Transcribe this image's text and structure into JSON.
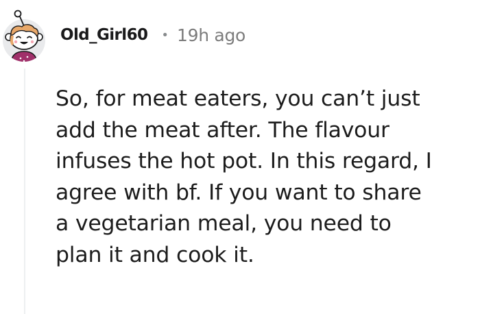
{
  "comment": {
    "author": "Old_Girl60",
    "separator": "•",
    "timestamp": "19h ago",
    "avatar_icon": "reddit-snoo-avatar-icon",
    "body_lines": [
      "So, for meat eaters, you can’t just",
      "add the meat after. The flavour",
      "infuses the hot pot. In this regard, I",
      "agree with bf. If you want to share",
      "a vegetarian meal, you need to",
      "plan it and cook it."
    ]
  },
  "colors": {
    "background": "#ffffff",
    "username": "#1a1a1b",
    "meta": "#7c7c7c",
    "body": "#1c1c1c",
    "thread_line": "#edeff1",
    "avatar_bg": "#e9eaec",
    "avatar_shirt": "#a0306a"
  }
}
